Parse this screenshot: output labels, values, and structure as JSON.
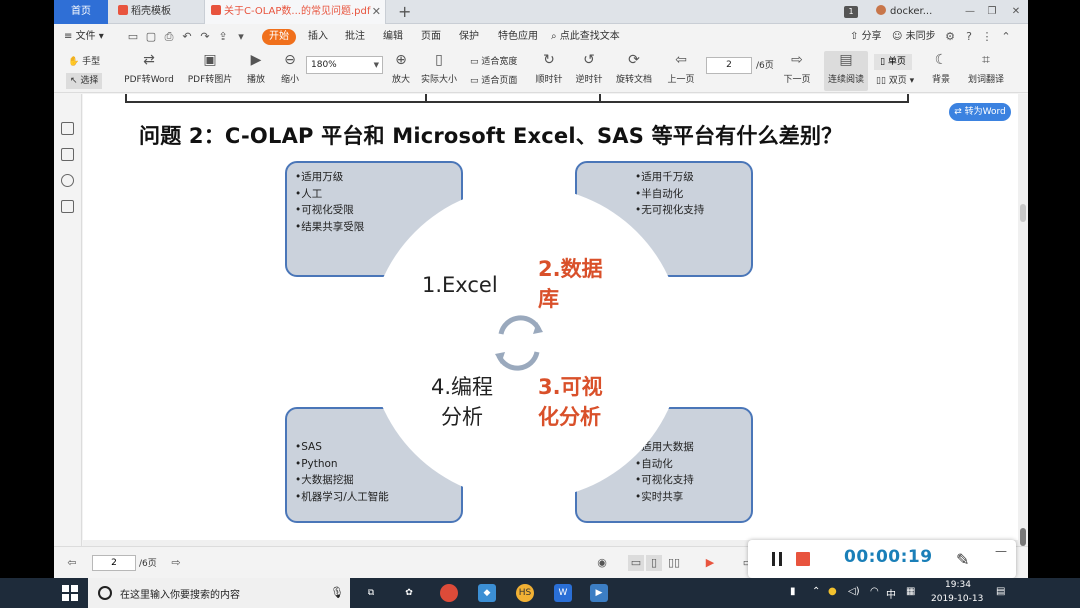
{
  "tabs": {
    "home": "首页",
    "template": "稻壳模板",
    "document": "关于C-OLAP数...的常见问题.pdf",
    "count": "1",
    "user": "docker..."
  },
  "menu": {
    "file": "文件",
    "start": "开始",
    "insert": "插入",
    "comment": "批注",
    "edit": "编辑",
    "page": "页面",
    "protect": "保护",
    "special": "特色应用",
    "search": "点此查找文本",
    "share": "分享",
    "sync": "未同步"
  },
  "toolbar": {
    "hand": "手型",
    "select": "选择",
    "pdf_to_word": "PDF转Word",
    "pdf_to_image": "PDF转图片",
    "play": "播放",
    "zoom_out": "缩小",
    "zoom_value": "180%",
    "zoom_in": "放大",
    "actual_size": "实际大小",
    "fit_width": "适合宽度",
    "fit_page": "适合页面",
    "clockwise": "顺时针",
    "counterclockwise": "逆时针",
    "rotate_doc": "旋转文档",
    "prev_page": "上一页",
    "page_value": "2",
    "page_total": "/6页",
    "next_page": "下一页",
    "continuous": "连续阅读",
    "single": "单页",
    "double": "双页",
    "background": "背景",
    "translate": "划词翻译"
  },
  "convert_button": "转为Word",
  "slide": {
    "title": "问题 2：C-OLAP 平台和 Microsoft Excel、SAS 等平台有什么差别？",
    "top_left": [
      "•适用万级",
      "•人工",
      "•可视化受限",
      "•结果共享受限"
    ],
    "top_right": [
      "•适用千万级",
      "•半自动化",
      "•无可视化支持"
    ],
    "bottom_left": [
      "•SAS",
      "•Python",
      "•大数据挖掘",
      "•机器学习/人工智能"
    ],
    "bottom_right": [
      "•适用大数据",
      "•自动化",
      "•可视化支持",
      "•实时共享"
    ],
    "q1": "1.Excel",
    "q2": "2.数据库",
    "q3": "3.可视化分析",
    "q4": "4.编程分析"
  },
  "status": {
    "page_value": "2",
    "page_total": "/6页"
  },
  "recorder": {
    "time": "00:00:19"
  },
  "taskbar": {
    "search_placeholder": "在这里输入你要搜索的内容",
    "ime": "中",
    "time": "19:34",
    "date": "2019-10-13"
  },
  "colors": {
    "accent_orange": "#f0701c",
    "box_fill": "#cbd2dc",
    "box_border": "#4a76b8",
    "highlight_red": "#d9502a",
    "timer_blue": "#1a7fb8"
  }
}
